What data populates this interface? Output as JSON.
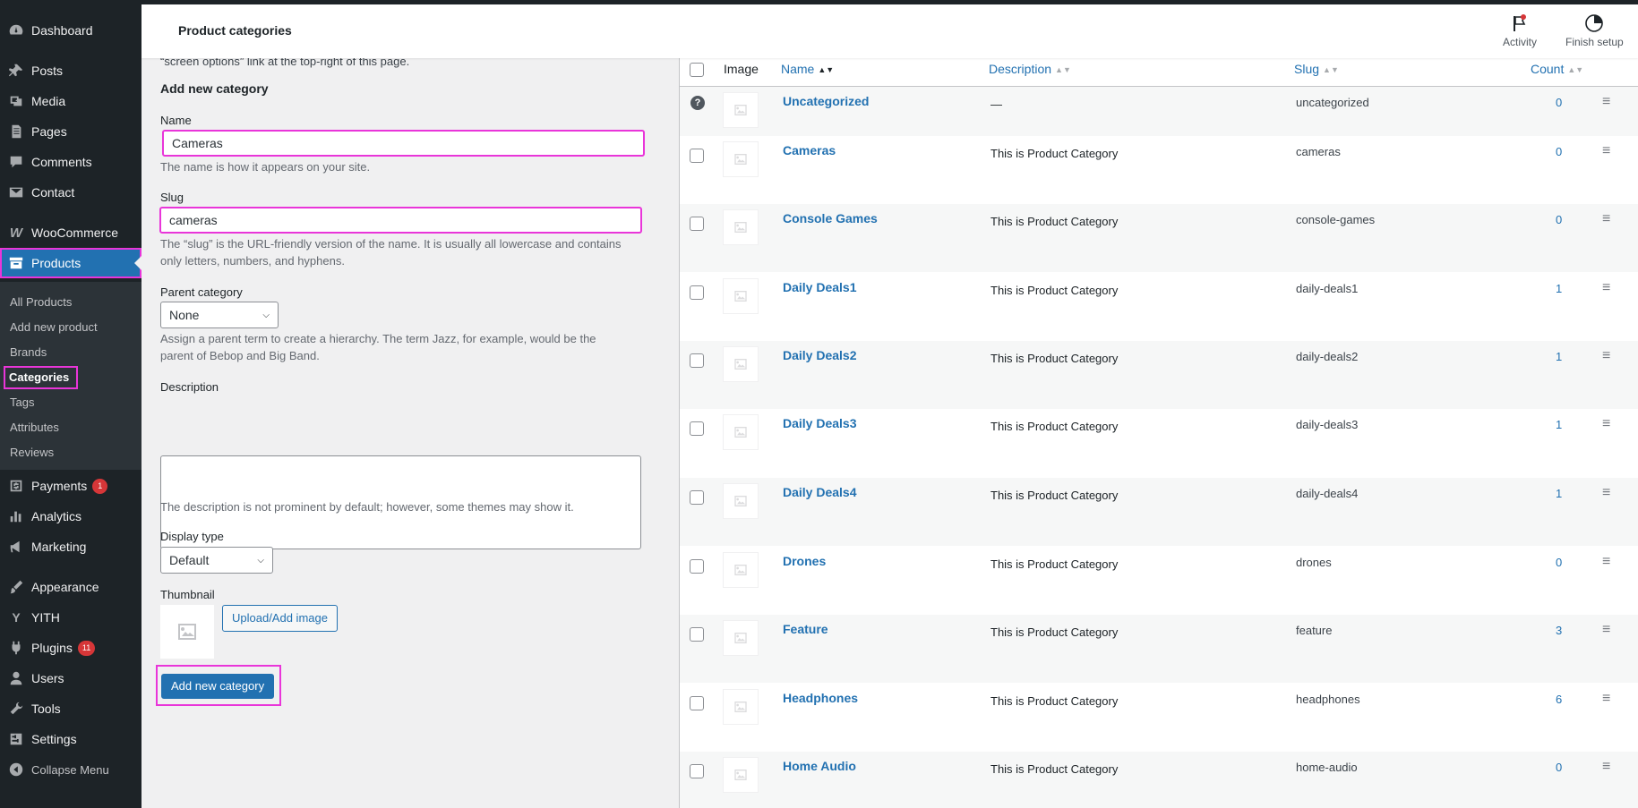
{
  "header": {
    "title": "Product categories",
    "activity": "Activity",
    "finish_setup": "Finish setup"
  },
  "sidebar": {
    "items": [
      {
        "label": "Dashboard",
        "icon": "dashboard-icon"
      },
      {
        "label": "Posts",
        "icon": "pin-icon"
      },
      {
        "label": "Media",
        "icon": "media-icon"
      },
      {
        "label": "Pages",
        "icon": "pages-icon"
      },
      {
        "label": "Comments",
        "icon": "comment-icon"
      },
      {
        "label": "Contact",
        "icon": "mail-icon"
      },
      {
        "label": "WooCommerce",
        "icon": "woo-icon"
      },
      {
        "label": "Products",
        "icon": "archive-icon"
      },
      {
        "label": "Payments",
        "icon": "payments-icon",
        "badge": "1"
      },
      {
        "label": "Analytics",
        "icon": "bar-chart-icon"
      },
      {
        "label": "Marketing",
        "icon": "megaphone-icon"
      },
      {
        "label": "Appearance",
        "icon": "brush-icon"
      },
      {
        "label": "YITH",
        "icon": "yith-icon"
      },
      {
        "label": "Plugins",
        "icon": "plug-icon",
        "badge": "11"
      },
      {
        "label": "Users",
        "icon": "user-icon"
      },
      {
        "label": "Tools",
        "icon": "wrench-icon"
      },
      {
        "label": "Settings",
        "icon": "settings-icon"
      },
      {
        "label": "Collapse Menu",
        "icon": "collapse-icon"
      }
    ],
    "submenu": [
      "All Products",
      "Add new product",
      "Brands",
      "Categories",
      "Tags",
      "Attributes",
      "Reviews"
    ]
  },
  "form": {
    "cut_text": "“screen options” link at the top-right of this page.",
    "heading": "Add new category",
    "name_label": "Name",
    "name_value": "Cameras",
    "name_help": "The name is how it appears on your site.",
    "slug_label": "Slug",
    "slug_value": "cameras",
    "slug_help_1": "The “slug” is the URL-friendly version of the name. It is usually all lowercase and contains",
    "slug_help_2": "only letters, numbers, and hyphens.",
    "parent_label": "Parent category",
    "parent_value": "None",
    "parent_help_1": "Assign a parent term to create a hierarchy. The term Jazz, for example, would be the",
    "parent_help_2": "parent of Bebop and Big Band.",
    "desc_label": "Description",
    "desc_help": "The description is not prominent by default; however, some themes may show it.",
    "display_label": "Display type",
    "display_value": "Default",
    "thumb_label": "Thumbnail",
    "upload_btn": "Upload/Add image",
    "submit_btn": "Add new category"
  },
  "table": {
    "headers": {
      "image": "Image",
      "name": "Name",
      "description": "Description",
      "slug": "Slug",
      "count": "Count"
    },
    "rows": [
      {
        "name": "Uncategorized",
        "desc": "—",
        "slug": "uncategorized",
        "count": "0"
      },
      {
        "name": "Cameras",
        "desc": "This is Product Category",
        "slug": "cameras",
        "count": "0"
      },
      {
        "name": "Console Games",
        "desc": "This is Product Category",
        "slug": "console-games",
        "count": "0"
      },
      {
        "name": "Daily Deals1",
        "desc": "This is Product Category",
        "slug": "daily-deals1",
        "count": "1"
      },
      {
        "name": "Daily Deals2",
        "desc": "This is Product Category",
        "slug": "daily-deals2",
        "count": "1"
      },
      {
        "name": "Daily Deals3",
        "desc": "This is Product Category",
        "slug": "daily-deals3",
        "count": "1"
      },
      {
        "name": "Daily Deals4",
        "desc": "This is Product Category",
        "slug": "daily-deals4",
        "count": "1"
      },
      {
        "name": "Drones",
        "desc": "This is Product Category",
        "slug": "drones",
        "count": "0"
      },
      {
        "name": "Feature",
        "desc": "This is Product Category",
        "slug": "feature",
        "count": "3"
      },
      {
        "name": "Headphones",
        "desc": "This is Product Category",
        "slug": "headphones",
        "count": "6"
      },
      {
        "name": "Home Audio",
        "desc": "This is Product Category",
        "slug": "home-audio",
        "count": "0"
      }
    ]
  },
  "colors": {
    "accent": "#2271b1",
    "highlight": "#e935d9",
    "sidebar": "#1d2327"
  }
}
